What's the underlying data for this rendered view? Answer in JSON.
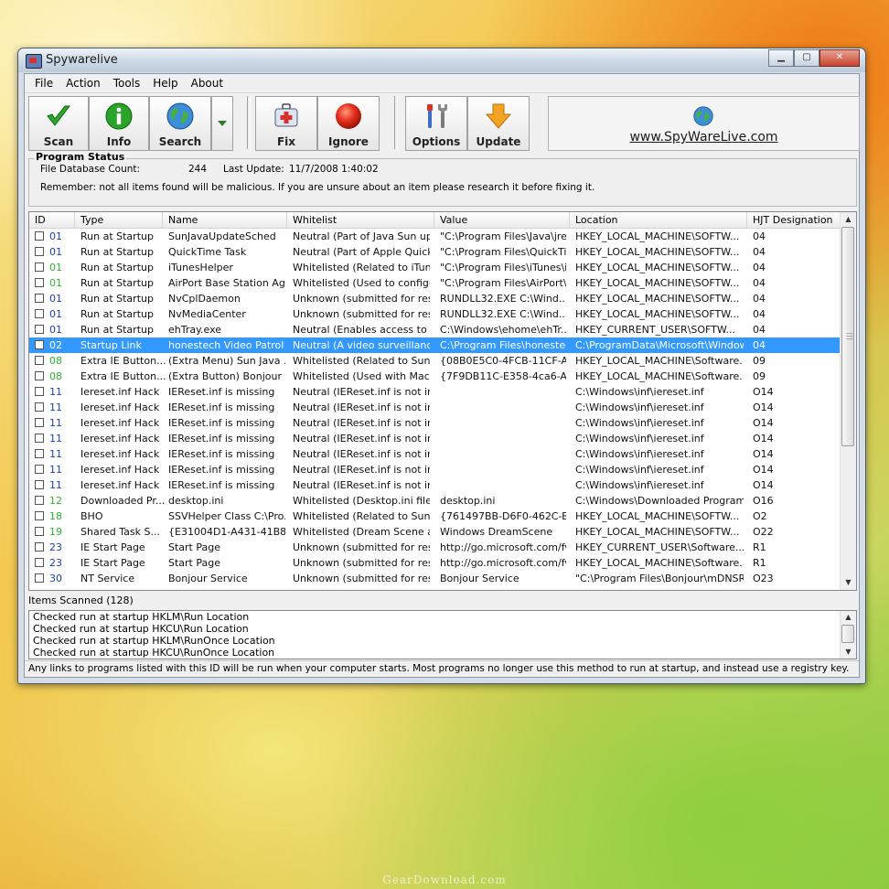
{
  "window": {
    "title": "Spywarelive"
  },
  "menu": [
    "File",
    "Action",
    "Tools",
    "Help",
    "About"
  ],
  "toolbar": {
    "scan": "Scan",
    "info": "Info",
    "search": "Search",
    "fix": "Fix",
    "ignore": "Ignore",
    "options": "Options",
    "update": "Update",
    "website": "www.SpyWareLive.com"
  },
  "status": {
    "legend": "Program Status",
    "db_label": "File Database Count:",
    "db_count": "244",
    "update_label": "Last Update:",
    "update_value": "11/7/2008 1:40:02",
    "remember": "Remember: not all items found will be malicious.  If you are unsure about an item please research it before fixing it."
  },
  "columns": [
    "ID",
    "Type",
    "Name",
    "Whitelist",
    "Value",
    "Location",
    "HJT Designation"
  ],
  "rows": [
    {
      "id": "01",
      "type": "Run at Startup",
      "name": "SunJavaUpdateSched",
      "whitelist": "Neutral (Part of Java Sun upd...",
      "value": "\"C:\\Program Files\\Java\\jre...",
      "location": "HKEY_LOCAL_MACHINE\\SOFTW...",
      "hjt": "04",
      "id_color": "#1a3fb0"
    },
    {
      "id": "01",
      "type": "Run at Startup",
      "name": "QuickTime Task",
      "whitelist": "Neutral (Part of Apple Quickti...",
      "value": "\"C:\\Program Files\\QuickTi...",
      "location": "HKEY_LOCAL_MACHINE\\SOFTW...",
      "hjt": "04",
      "id_color": "#1a3fb0"
    },
    {
      "id": "01",
      "type": "Run at Startup",
      "name": "iTunesHelper",
      "whitelist": "Whitelisted (Related to iTune...",
      "value": "\"C:\\Program Files\\iTunes\\i...",
      "location": "HKEY_LOCAL_MACHINE\\SOFTW...",
      "hjt": "04",
      "id_color": "#2db22d"
    },
    {
      "id": "01",
      "type": "Run at Startup",
      "name": "AirPort Base Station Ag...",
      "whitelist": "Whitelisted (Used to configur...",
      "value": "\"C:\\Program Files\\AirPort\\...",
      "location": "HKEY_LOCAL_MACHINE\\SOFTW...",
      "hjt": "04",
      "id_color": "#2db22d"
    },
    {
      "id": "01",
      "type": "Run at Startup",
      "name": "NvCplDaemon",
      "whitelist": "Unknown (submitted for rese...",
      "value": "RUNDLL32.EXE C:\\Wind...",
      "location": "HKEY_LOCAL_MACHINE\\SOFTW...",
      "hjt": "04",
      "id_color": "#1a3fb0"
    },
    {
      "id": "01",
      "type": "Run at Startup",
      "name": "NvMediaCenter",
      "whitelist": "Unknown (submitted for rese...",
      "value": "RUNDLL32.EXE C:\\Wind...",
      "location": "HKEY_LOCAL_MACHINE\\SOFTW...",
      "hjt": "04",
      "id_color": "#1a3fb0"
    },
    {
      "id": "01",
      "type": "Run at Startup",
      "name": "ehTray.exe",
      "whitelist": "Neutral (Enables access to ...",
      "value": "C:\\Windows\\ehome\\ehTr...",
      "location": "HKEY_CURRENT_USER\\SOFTW...",
      "hjt": "04",
      "id_color": "#1a3fb0"
    },
    {
      "id": "02",
      "type": "Startup Link",
      "name": "honestech Video Patrol ...",
      "whitelist": "Neutral (A video surveillance ...",
      "value": "C:\\Program Files\\honestec...",
      "location": "C:\\ProgramData\\Microsoft\\Window...",
      "hjt": "04",
      "id_color": "#ffffff",
      "selected": true
    },
    {
      "id": "08",
      "type": "Extra IE Button...",
      "name": "(Extra Menu) Sun Java ...",
      "whitelist": "Whitelisted (Related to Sun J...",
      "value": "{08B0E5C0-4FCB-11CF-A...",
      "location": "HKEY_LOCAL_MACHINE\\Software...",
      "hjt": "09",
      "id_color": "#2db22d"
    },
    {
      "id": "08",
      "type": "Extra IE Button...",
      "name": "(Extra Button) Bonjour",
      "whitelist": "Whitelisted (Used with Mac A...",
      "value": "{7F9DB11C-E358-4ca6-A8...",
      "location": "HKEY_LOCAL_MACHINE\\Software...",
      "hjt": "09",
      "id_color": "#2db22d"
    },
    {
      "id": "11",
      "type": "Iereset.inf Hack",
      "name": "IEReset.inf is missing",
      "whitelist": "Neutral (IEReset.inf is not incl...",
      "value": "",
      "location": "C:\\Windows\\inf\\iereset.inf",
      "hjt": "O14",
      "id_color": "#1a3fb0"
    },
    {
      "id": "11",
      "type": "Iereset.inf Hack",
      "name": "IEReset.inf is missing",
      "whitelist": "Neutral (IEReset.inf is not incl...",
      "value": "",
      "location": "C:\\Windows\\inf\\iereset.inf",
      "hjt": "O14",
      "id_color": "#1a3fb0"
    },
    {
      "id": "11",
      "type": "Iereset.inf Hack",
      "name": "IEReset.inf is missing",
      "whitelist": "Neutral (IEReset.inf is not incl...",
      "value": "",
      "location": "C:\\Windows\\inf\\iereset.inf",
      "hjt": "O14",
      "id_color": "#1a3fb0"
    },
    {
      "id": "11",
      "type": "Iereset.inf Hack",
      "name": "IEReset.inf is missing",
      "whitelist": "Neutral (IEReset.inf is not incl...",
      "value": "",
      "location": "C:\\Windows\\inf\\iereset.inf",
      "hjt": "O14",
      "id_color": "#1a3fb0"
    },
    {
      "id": "11",
      "type": "Iereset.inf Hack",
      "name": "IEReset.inf is missing",
      "whitelist": "Neutral (IEReset.inf is not incl...",
      "value": "",
      "location": "C:\\Windows\\inf\\iereset.inf",
      "hjt": "O14",
      "id_color": "#1a3fb0"
    },
    {
      "id": "11",
      "type": "Iereset.inf Hack",
      "name": "IEReset.inf is missing",
      "whitelist": "Neutral (IEReset.inf is not incl...",
      "value": "",
      "location": "C:\\Windows\\inf\\iereset.inf",
      "hjt": "O14",
      "id_color": "#1a3fb0"
    },
    {
      "id": "11",
      "type": "Iereset.inf Hack",
      "name": "IEReset.inf is missing",
      "whitelist": "Neutral (IEReset.inf is not incl...",
      "value": "",
      "location": "C:\\Windows\\inf\\iereset.inf",
      "hjt": "O14",
      "id_color": "#1a3fb0"
    },
    {
      "id": "12",
      "type": "Downloaded Pr...",
      "name": "desktop.ini",
      "whitelist": "Whitelisted (Desktop.ini files s...",
      "value": "desktop.ini",
      "location": "C:\\Windows\\Downloaded Program ...",
      "hjt": "O16",
      "id_color": "#2db22d"
    },
    {
      "id": "18",
      "type": "BHO",
      "name": "SSVHelper Class C:\\Pro...",
      "whitelist": "Whitelisted (Related to Sun J...",
      "value": "{761497BB-D6F0-462C-B6...",
      "location": "HKEY_LOCAL_MACHINE\\SOFTW...",
      "hjt": "O2",
      "id_color": "#2db22d"
    },
    {
      "id": "19",
      "type": "Shared Task S...",
      "name": "{E31004D1-A431-41B8-...",
      "whitelist": "Whitelisted (Dream Scene all...",
      "value": "Windows DreamScene",
      "location": "HKEY_LOCAL_MACHINE\\SOFTW...",
      "hjt": "O22",
      "id_color": "#2db22d"
    },
    {
      "id": "23",
      "type": "IE Start Page",
      "name": "Start Page",
      "whitelist": "Unknown (submitted for rese...",
      "value": "http://go.microsoft.com/fw...",
      "location": "HKEY_CURRENT_USER\\Software...",
      "hjt": "R1",
      "id_color": "#1a3fb0"
    },
    {
      "id": "23",
      "type": "IE Start Page",
      "name": "Start Page",
      "whitelist": "Unknown (submitted for rese...",
      "value": "http://go.microsoft.com/fw...",
      "location": "HKEY_LOCAL_MACHINE\\Software...",
      "hjt": "R1",
      "id_color": "#1a3fb0"
    },
    {
      "id": "30",
      "type": "NT Service",
      "name": "Bonjour Service",
      "whitelist": "Unknown (submitted for rese...",
      "value": "Bonjour Service",
      "location": "\"C:\\Program Files\\Bonjour\\mDNSR...",
      "hjt": "O23",
      "id_color": "#1a3fb0"
    }
  ],
  "items_scanned": "Items Scanned (128)",
  "log": [
    "Checked run at startup HKLM\\Run Location",
    "Checked run at startup HKCU\\Run Location",
    "Checked run at startup HKLM\\RunOnce Location",
    "Checked run at startup HKCU\\RunOnce Location"
  ],
  "statusbar": "Any links to programs listed with this ID will be run when your computer starts.  Most programs no longer use this method to run at startup, and instead use a registry key.",
  "watermark": "GearDownload.com",
  "colors": {
    "selected_row": "#3399ff",
    "whitelisted_id": "#2db22d",
    "neutral_id": "#1a3fb0"
  }
}
